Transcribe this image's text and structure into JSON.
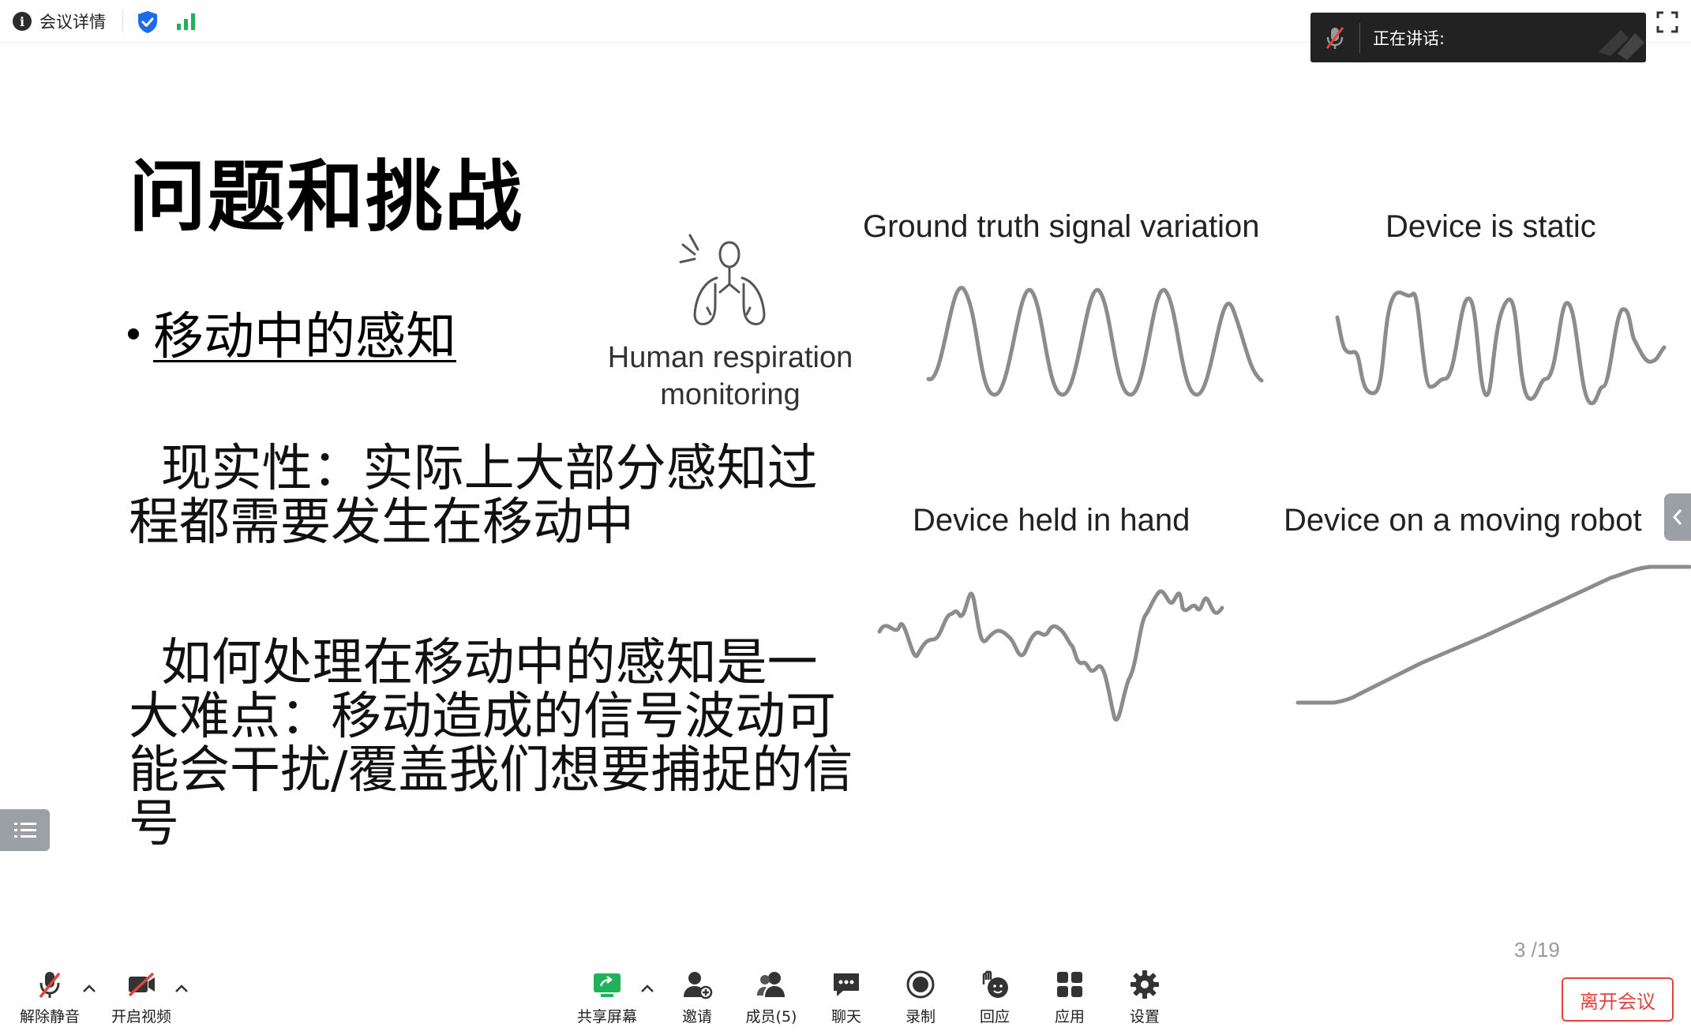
{
  "topbar": {
    "meeting_info_label": "会议详情",
    "icons": [
      "info-icon",
      "shield-icon",
      "signal-icon",
      "fullscreen-icon"
    ]
  },
  "speaking_panel": {
    "label": "正在讲话:",
    "icon": "mic-muted-icon"
  },
  "slide": {
    "title": "问题和挑战",
    "bullet": "移动中的感知",
    "paragraph1": "  现实性：实际上大部分感知过程都需要发生在移动中",
    "paragraph2": "  如何处理在移动中的感知是一大难点：移动造成的信号波动可能会干扰/覆盖我们想要捕捉的信号",
    "respiration_label": "Human respiration monitoring",
    "wave_titles": {
      "ground_truth": "Ground truth signal variation",
      "static": "Device is static",
      "hand": "Device held in hand",
      "robot": "Device on a moving robot"
    },
    "page_indicator": "3 /19",
    "colors": {
      "wave": "#8c8c8c",
      "text": "#111111"
    }
  },
  "toolbar": {
    "unmute": "解除静音",
    "start_video": "开启视频",
    "share_screen": "共享屏幕",
    "invite": "邀请",
    "members": "成员(5)",
    "chat": "聊天",
    "record": "录制",
    "react": "回应",
    "apps": "应用",
    "settings": "设置",
    "leave": "离开会议",
    "colors": {
      "leave": "#e0443e",
      "share": "#1fb25a",
      "muted": "#e0443e"
    }
  }
}
